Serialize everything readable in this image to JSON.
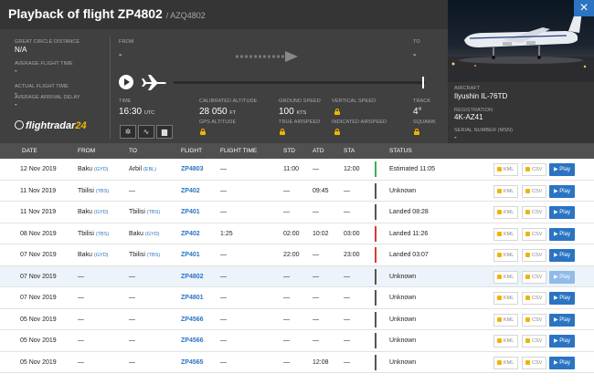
{
  "header": {
    "title": "Playback of flight ZP4802",
    "subtitle": "/ AZQ4802",
    "close_icon": "×"
  },
  "stats": {
    "distance_label": "GREAT CIRCLE DISTANCE",
    "distance_value": "N/A",
    "avg_flight_time_label": "AVERAGE FLIGHT TIME",
    "avg_flight_time_value": "-",
    "actual_flight_time_label": "ACTUAL FLIGHT TIME",
    "actual_flight_time_value": "-",
    "avg_arrival_delay_label": "AVERAGE ARRIVAL DELAY",
    "avg_arrival_delay_value": "-"
  },
  "route": {
    "from_label": "FROM",
    "from_value": "-",
    "to_label": "TO",
    "to_value": "-"
  },
  "playback": {
    "time_label": "TIME",
    "time_value": "16:30",
    "time_unit": "UTC",
    "cal_alt_label": "CALIBRATED ALTITUDE",
    "cal_alt_value": "28 050",
    "cal_alt_unit": "FT",
    "gps_alt_label": "GPS ALTITUDE",
    "ground_speed_label": "GROUND SPEED",
    "ground_speed_value": "100",
    "ground_speed_unit": "KTS",
    "true_airspeed_label": "TRUE AIRSPEED",
    "vertical_speed_label": "VERTICAL SPEED",
    "indicated_airspeed_label": "INDICATED AIRSPEED",
    "track_label": "TRACK",
    "track_value": "4°",
    "squawk_label": "SQUAWK"
  },
  "mini_buttons": [
    "✲",
    "∿",
    "▆"
  ],
  "brand": {
    "name": "flightradar",
    "suffix": "24"
  },
  "aircraft": {
    "aircraft_label": "AIRCRAFT",
    "aircraft_value": "Ilyushin IL-76TD",
    "registration_label": "REGISTRATION",
    "registration_value": "4K-AZ41",
    "serial_label": "SERIAL NUMBER (MSN)",
    "serial_value": "-"
  },
  "table": {
    "headers": [
      "DATE",
      "FROM",
      "TO",
      "FLIGHT",
      "FLIGHT TIME",
      "STD",
      "ATD",
      "STA",
      "STATUS"
    ],
    "kml_label": "KML",
    "csv_label": "CSV",
    "play_label": "▶ Play",
    "rows": [
      {
        "date": "12 Nov 2019",
        "from": "Baku",
        "from_code": "(GYD)",
        "to": "Arbil",
        "to_code": "(EBL)",
        "flight": "ZP4803",
        "time": "—",
        "std": "11:00",
        "atd": "—",
        "sta": "12:00",
        "status": "Estimated 11:05",
        "bar": "green",
        "sel": false
      },
      {
        "date": "11 Nov 2019",
        "from": "Tbilisi",
        "from_code": "(TBS)",
        "to": "—",
        "to_code": "",
        "flight": "ZP402",
        "time": "—",
        "std": "—",
        "atd": "09:45",
        "sta": "—",
        "status": "Unknown",
        "bar": "grey",
        "sel": false
      },
      {
        "date": "11 Nov 2019",
        "from": "Baku",
        "from_code": "(GYD)",
        "to": "Tbilisi",
        "to_code": "(TBS)",
        "flight": "ZP401",
        "time": "—",
        "std": "—",
        "atd": "—",
        "sta": "—",
        "status": "Landed 08:28",
        "bar": "grey",
        "sel": false
      },
      {
        "date": "08 Nov 2019",
        "from": "Tbilisi",
        "from_code": "(TBS)",
        "to": "Baku",
        "to_code": "(GYD)",
        "flight": "ZP402",
        "time": "1:25",
        "std": "02:00",
        "atd": "10:02",
        "sta": "03:00",
        "status": "Landed 11:26",
        "bar": "red",
        "sel": false
      },
      {
        "date": "07 Nov 2019",
        "from": "Baku",
        "from_code": "(GYD)",
        "to": "Tbilisi",
        "to_code": "(TBS)",
        "flight": "ZP401",
        "time": "—",
        "std": "22:00",
        "atd": "—",
        "sta": "23:00",
        "status": "Landed 03:07",
        "bar": "red",
        "sel": false
      },
      {
        "date": "07 Nov 2019",
        "from": "—",
        "from_code": "",
        "to": "—",
        "to_code": "",
        "flight": "ZP4802",
        "time": "—",
        "std": "—",
        "atd": "—",
        "sta": "—",
        "status": "Unknown",
        "bar": "grey",
        "sel": true
      },
      {
        "date": "07 Nov 2019",
        "from": "—",
        "from_code": "",
        "to": "—",
        "to_code": "",
        "flight": "ZP4801",
        "time": "—",
        "std": "—",
        "atd": "—",
        "sta": "—",
        "status": "Unknown",
        "bar": "grey",
        "sel": false
      },
      {
        "date": "05 Nov 2019",
        "from": "—",
        "from_code": "",
        "to": "—",
        "to_code": "",
        "flight": "ZP4566",
        "time": "—",
        "std": "—",
        "atd": "—",
        "sta": "—",
        "status": "Unknown",
        "bar": "grey",
        "sel": false
      },
      {
        "date": "05 Nov 2019",
        "from": "—",
        "from_code": "",
        "to": "—",
        "to_code": "",
        "flight": "ZP4566",
        "time": "—",
        "std": "—",
        "atd": "—",
        "sta": "—",
        "status": "Unknown",
        "bar": "grey",
        "sel": false
      },
      {
        "date": "05 Nov 2019",
        "from": "—",
        "from_code": "",
        "to": "—",
        "to_code": "",
        "flight": "ZP4565",
        "time": "—",
        "std": "—",
        "atd": "12:08",
        "sta": "—",
        "status": "Unknown",
        "bar": "grey",
        "sel": false
      }
    ]
  },
  "colors": {
    "accent": "#2a74c2",
    "lock": "#f0b400",
    "ontime": "#3cb04a",
    "delayed": "#d63b3b"
  }
}
